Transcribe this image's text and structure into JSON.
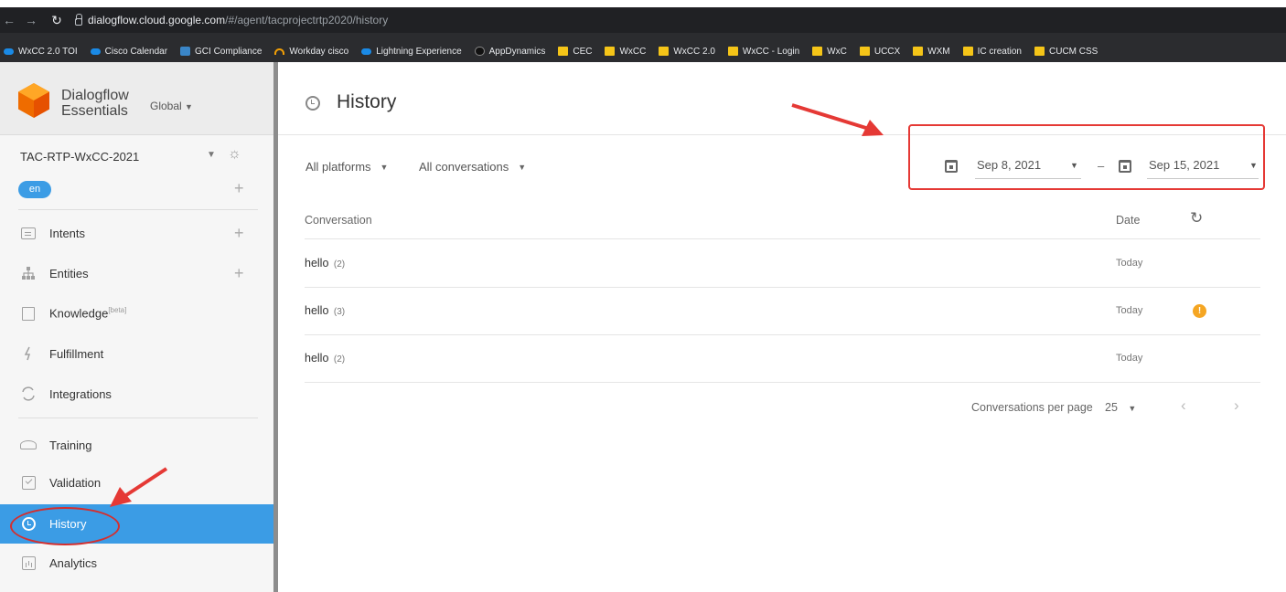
{
  "browser": {
    "url_host": "dialogflow.cloud.google.com",
    "url_path": "/#/agent/tacprojectrtp2020/history",
    "bookmarks": [
      {
        "label": "WxCC 2.0 TOI",
        "icon": "cloud-icon"
      },
      {
        "label": "Cisco Calendar",
        "icon": "cloud-icon"
      },
      {
        "label": "GCI Compliance",
        "icon": "gci-icon"
      },
      {
        "label": "Workday cisco",
        "icon": "workday-icon"
      },
      {
        "label": "Lightning Experience",
        "icon": "cloud-icon"
      },
      {
        "label": "AppDynamics",
        "icon": "appdynamics-icon"
      },
      {
        "label": "CEC",
        "icon": "folder-icon"
      },
      {
        "label": "WxCC",
        "icon": "folder-icon"
      },
      {
        "label": "WxCC 2.0",
        "icon": "folder-icon"
      },
      {
        "label": "WxCC - Login",
        "icon": "folder-icon"
      },
      {
        "label": "WxC",
        "icon": "folder-icon"
      },
      {
        "label": "UCCX",
        "icon": "folder-icon"
      },
      {
        "label": "WXM",
        "icon": "folder-icon"
      },
      {
        "label": "IC creation",
        "icon": "folder-icon"
      },
      {
        "label": "CUCM CSS",
        "icon": "folder-icon"
      }
    ]
  },
  "sidebar": {
    "brand_line1": "Dialogflow",
    "brand_line2": "Essentials",
    "region": "Global",
    "agent_name": "TAC-RTP-WxCC-2021",
    "language": "en",
    "items": [
      {
        "label": "Intents",
        "icon": "chat-icon",
        "plus": true
      },
      {
        "label": "Entities",
        "icon": "hierarchy-icon",
        "plus": true
      },
      {
        "label": "Knowledge",
        "badge": "[beta]",
        "icon": "book-icon"
      },
      {
        "label": "Fulfillment",
        "icon": "bolt-icon"
      },
      {
        "label": "Integrations",
        "icon": "cycle-icon"
      },
      {
        "label": "Training",
        "icon": "graduation-cap-icon"
      },
      {
        "label": "Validation",
        "icon": "checkbox-icon"
      },
      {
        "label": "History",
        "icon": "clock-icon",
        "active": true
      },
      {
        "label": "Analytics",
        "icon": "bar-chart-icon"
      }
    ]
  },
  "main": {
    "title": "History",
    "filters": {
      "platforms": "All platforms",
      "conversations": "All conversations"
    },
    "date_range": {
      "from": "Sep 8, 2021",
      "separator": "–",
      "to": "Sep 15, 2021"
    },
    "table": {
      "col_conversation": "Conversation",
      "col_date": "Date",
      "rows": [
        {
          "text": "hello",
          "count": "(2)",
          "date": "Today",
          "warning": false
        },
        {
          "text": "hello",
          "count": "(3)",
          "date": "Today",
          "warning": true,
          "warning_glyph": "!"
        },
        {
          "text": "hello",
          "count": "(2)",
          "date": "Today",
          "warning": false
        }
      ]
    },
    "pagination": {
      "label": "Conversations per page",
      "per_page": "25"
    }
  },
  "colors": {
    "accent": "#3b9ce5",
    "annotation_red": "#e53935",
    "warning": "#f5a623",
    "chrome_dark": "#202124"
  }
}
